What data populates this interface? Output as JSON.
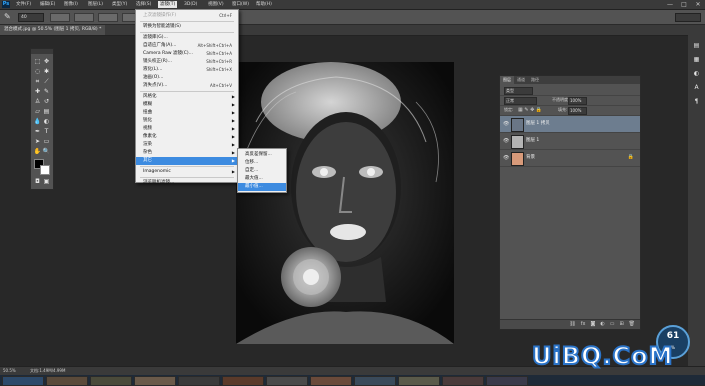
{
  "app": {
    "logo": "Ps"
  },
  "menubar": {
    "items": [
      "文件(F)",
      "编辑(E)",
      "图像(I)",
      "图层(L)",
      "类型(Y)",
      "选择(S)",
      "滤镜(T)",
      "3D(D)",
      "视图(V)",
      "窗口(W)",
      "帮助(H)"
    ],
    "active_index": 6
  },
  "window_controls": {
    "minimize": "—",
    "maximize": "□",
    "close": "✕"
  },
  "options_bar": {
    "tool_icon": "brush-icon",
    "mode_value": "40"
  },
  "document_tab": {
    "title": "混合模式.jpg @ 50.5% (图层 1 拷贝, RGB/8) *"
  },
  "filter_menu": {
    "groups": [
      [
        {
          "label": "上次滤镜操作(F)",
          "shortcut": "Ctrl+F",
          "disabled": true
        }
      ],
      [
        {
          "label": "转换为智能滤镜(S)",
          "shortcut": ""
        }
      ],
      [
        {
          "label": "滤镜库(G)...",
          "shortcut": ""
        },
        {
          "label": "自适应广角(A)...",
          "shortcut": "Alt+Shift+Ctrl+A"
        },
        {
          "label": "Camera Raw 滤镜(C)...",
          "shortcut": "Shift+Ctrl+A"
        },
        {
          "label": "镜头校正(R)...",
          "shortcut": "Shift+Ctrl+R"
        },
        {
          "label": "液化(L)...",
          "shortcut": "Shift+Ctrl+X"
        },
        {
          "label": "油画(O)...",
          "shortcut": ""
        },
        {
          "label": "消失点(V)...",
          "shortcut": "Alt+Ctrl+V"
        }
      ],
      [
        {
          "label": "风格化",
          "submenu": true
        },
        {
          "label": "模糊",
          "submenu": true
        },
        {
          "label": "扭曲",
          "submenu": true
        },
        {
          "label": "锐化",
          "submenu": true
        },
        {
          "label": "视频",
          "submenu": true
        },
        {
          "label": "像素化",
          "submenu": true
        },
        {
          "label": "渲染",
          "submenu": true
        },
        {
          "label": "杂色",
          "submenu": true
        },
        {
          "label": "其它",
          "submenu": true,
          "highlighted": true
        }
      ],
      [
        {
          "label": "Imagenomic",
          "submenu": true
        }
      ],
      [
        {
          "label": "浏览联机滤镜...",
          "shortcut": ""
        }
      ]
    ]
  },
  "other_submenu": {
    "items": [
      {
        "label": "高反差保留..."
      },
      {
        "label": "位移..."
      },
      {
        "label": "自定..."
      },
      {
        "label": "最大值..."
      },
      {
        "label": "最小值...",
        "highlighted": true
      }
    ]
  },
  "layers_panel": {
    "tabs": [
      "图层",
      "通道",
      "路径"
    ],
    "kind_filter": "类型",
    "blend_mode": "正常",
    "opacity_label": "不透明度:",
    "opacity_value": "100%",
    "lock_label": "锁定:",
    "fill_label": "填充:",
    "fill_value": "100%",
    "layers": [
      {
        "name": "图层 1 拷贝",
        "selected": true,
        "visible": true,
        "locked": false
      },
      {
        "name": "图层 1",
        "selected": false,
        "visible": true,
        "locked": false
      },
      {
        "name": "背景",
        "selected": false,
        "visible": true,
        "locked": true
      }
    ],
    "footer_icons": [
      "link-icon",
      "fx-icon",
      "mask-icon",
      "adjustment-icon",
      "group-icon",
      "new-layer-icon",
      "trash-icon"
    ]
  },
  "status_bar": {
    "zoom": "50.5%",
    "doc_info": "文档:1.49M/4.99M"
  },
  "zoom_badge": {
    "value": "61",
    "unit": "%"
  },
  "watermark": {
    "text": "UiBQ.CoM"
  },
  "colors": {
    "menu_highlight": "#3d8be0",
    "layer_selected": "#6d7d8f",
    "panel_bg": "#535353",
    "workspace_bg": "#282828"
  }
}
